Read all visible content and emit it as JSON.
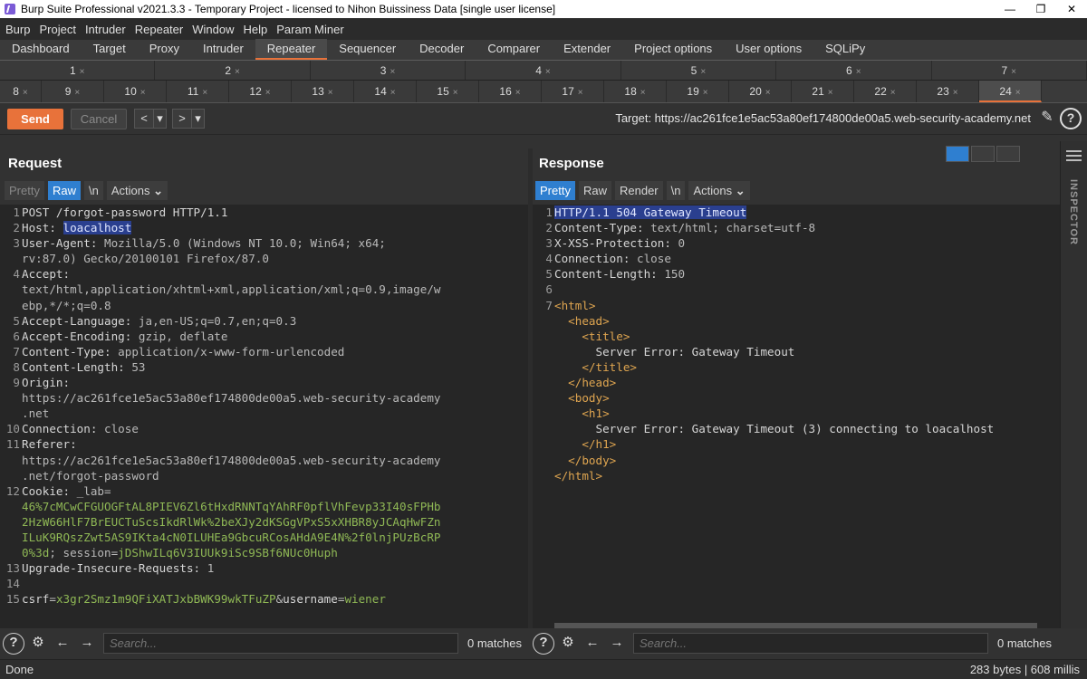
{
  "window": {
    "title": "Burp Suite Professional v2021.3.3 - Temporary Project - licensed to Nihon Buissiness Data [single user license]",
    "min": "—",
    "restore": "❐",
    "close": "✕"
  },
  "menu": [
    "Burp",
    "Project",
    "Intruder",
    "Repeater",
    "Window",
    "Help",
    "Param Miner"
  ],
  "main_tabs": [
    "Dashboard",
    "Target",
    "Proxy",
    "Intruder",
    "Repeater",
    "Sequencer",
    "Decoder",
    "Comparer",
    "Extender",
    "Project options",
    "User options",
    "SQLiPy"
  ],
  "active_main_tab": "Repeater",
  "repeater_tabs_row1": [
    "1",
    "2",
    "3",
    "4",
    "5",
    "6",
    "7"
  ],
  "repeater_tabs_row2": [
    "8",
    "9",
    "10",
    "11",
    "12",
    "13",
    "14",
    "15",
    "16",
    "17",
    "18",
    "19",
    "20",
    "21",
    "22",
    "23",
    "24"
  ],
  "active_repeater_tab": "24",
  "toolbar": {
    "send": "Send",
    "cancel": "Cancel",
    "back": "<",
    "fwd": ">",
    "dropdown": "▾",
    "target": "Target: https://ac261fce1e5ac53a80ef174800de00a5.web-security-academy.net",
    "edit_icon": "✎",
    "help_icon": "?"
  },
  "request": {
    "title": "Request",
    "tabs": [
      "Pretty",
      "Raw",
      "\\n"
    ],
    "active_tab": "Raw",
    "actions": "Actions",
    "search_placeholder": "Search...",
    "matches": "0 matches"
  },
  "response": {
    "title": "Response",
    "tabs": [
      "Pretty",
      "Raw",
      "Render",
      "\\n"
    ],
    "active_tab": "Pretty",
    "actions": "Actions",
    "search_placeholder": "Search...",
    "matches": "0 matches"
  },
  "inspector": "INSPECTOR",
  "status": {
    "left": "Done",
    "right": "283 bytes | 608 millis"
  },
  "request_lines": [
    [
      "1",
      [
        [
          "POST /forgot-password HTTP/1.1",
          ""
        ]
      ]
    ],
    [
      "2",
      [
        [
          "Host: ",
          ""
        ],
        [
          "loacalhost",
          "hl"
        ]
      ]
    ],
    [
      "3",
      [
        [
          "User-Agent: ",
          ""
        ],
        [
          "Mozilla/5.0 (Windows NT 10.0; Win64; x64;",
          "val"
        ]
      ]
    ],
    [
      "",
      [
        [
          "rv:87.0) Gecko/20100101 Firefox/87.0",
          "val"
        ]
      ]
    ],
    [
      "4",
      [
        [
          "Accept:",
          ""
        ]
      ]
    ],
    [
      "",
      [
        [
          "text/html,application/xhtml+xml,application/xml;q=0.9,image/w",
          "val"
        ]
      ]
    ],
    [
      "",
      [
        [
          "ebp,*/*;q=0.8",
          "val"
        ]
      ]
    ],
    [
      "5",
      [
        [
          "Accept-Language: ",
          ""
        ],
        [
          "ja,en-US;q=0.7,en;q=0.3",
          "val"
        ]
      ]
    ],
    [
      "6",
      [
        [
          "Accept-Encoding: ",
          ""
        ],
        [
          "gzip, deflate",
          "val"
        ]
      ]
    ],
    [
      "7",
      [
        [
          "Content-Type: ",
          ""
        ],
        [
          "application/x-www-form-urlencoded",
          "val"
        ]
      ]
    ],
    [
      "8",
      [
        [
          "Content-Length: ",
          ""
        ],
        [
          "53",
          "val"
        ]
      ]
    ],
    [
      "9",
      [
        [
          "Origin:",
          ""
        ]
      ]
    ],
    [
      "",
      [
        [
          "https://ac261fce1e5ac53a80ef174800de00a5.web-security-academy",
          "val"
        ]
      ]
    ],
    [
      "",
      [
        [
          ".net",
          "val"
        ]
      ]
    ],
    [
      "10",
      [
        [
          "Connection: ",
          ""
        ],
        [
          "close",
          "val"
        ]
      ]
    ],
    [
      "11",
      [
        [
          "Referer:",
          ""
        ]
      ]
    ],
    [
      "",
      [
        [
          "https://ac261fce1e5ac53a80ef174800de00a5.web-security-academy",
          "val"
        ]
      ]
    ],
    [
      "",
      [
        [
          ".net/forgot-password",
          "val"
        ]
      ]
    ],
    [
      "12",
      [
        [
          "Cookie: ",
          ""
        ],
        [
          "_lab=",
          "val"
        ]
      ]
    ],
    [
      "",
      [
        [
          "46%7cMCwCFGUOGFtAL8PIEV6Zl6tHxdRNNTqYAhRF0pflVhFevp33I40sFPHb",
          "grn"
        ]
      ]
    ],
    [
      "",
      [
        [
          "2HzW66HlF7BrEUCTuScsIkdRlWk%2beXJy2dKSGgVPxS5xXHBR8yJCAqHwFZn",
          "grn"
        ]
      ]
    ],
    [
      "",
      [
        [
          "ILuK9RQszZwt5AS9IKta4cN0ILUHEa9GbcuRCosAHdA9E4N%2f0lnjPUzBcRP",
          "grn"
        ]
      ]
    ],
    [
      "",
      [
        [
          "0%3d",
          "grn"
        ],
        [
          "; session=",
          "val"
        ],
        [
          "jDShwILq6V3IUUk9iSc9SBf6NUc0Huph",
          "grn"
        ]
      ]
    ],
    [
      "13",
      [
        [
          "Upgrade-Insecure-Requests: ",
          ""
        ],
        [
          "1",
          "val"
        ]
      ]
    ],
    [
      "14",
      [
        [
          "",
          ""
        ]
      ]
    ],
    [
      "15",
      [
        [
          "csrf",
          ""
        ],
        [
          "=",
          "val"
        ],
        [
          "x3gr2Smz1m9QFiXATJxbBWK99wkTFuZP",
          "grn"
        ],
        [
          "&",
          "val"
        ],
        [
          "username",
          ""
        ],
        [
          "=",
          "val"
        ],
        [
          "wiener",
          "grn"
        ]
      ]
    ]
  ],
  "response_lines": [
    [
      "1",
      [
        [
          "HTTP/1.1 504 Gateway Timeout",
          "hl"
        ]
      ]
    ],
    [
      "2",
      [
        [
          "Content-Type: ",
          ""
        ],
        [
          "text/html; charset=utf-8",
          "val"
        ]
      ]
    ],
    [
      "3",
      [
        [
          "X-XSS-Protection: ",
          ""
        ],
        [
          "0",
          "val"
        ]
      ]
    ],
    [
      "4",
      [
        [
          "Connection: ",
          ""
        ],
        [
          "close",
          "val"
        ]
      ]
    ],
    [
      "5",
      [
        [
          "Content-Length: ",
          ""
        ],
        [
          "150",
          "val"
        ]
      ]
    ],
    [
      "6",
      [
        [
          "",
          ""
        ]
      ]
    ],
    [
      "7",
      [
        [
          "<html>",
          "tag"
        ]
      ]
    ],
    [
      "",
      [
        [
          "  <head>",
          "tag"
        ]
      ]
    ],
    [
      "",
      [
        [
          "    <title>",
          "tag"
        ]
      ]
    ],
    [
      "",
      [
        [
          "      Server Error: Gateway Timeout",
          ""
        ]
      ]
    ],
    [
      "",
      [
        [
          "    </title>",
          "tag"
        ]
      ]
    ],
    [
      "",
      [
        [
          "  </head>",
          "tag"
        ]
      ]
    ],
    [
      "",
      [
        [
          "  <body>",
          "tag"
        ]
      ]
    ],
    [
      "",
      [
        [
          "    <h1>",
          "tag"
        ]
      ]
    ],
    [
      "",
      [
        [
          "      Server Error: Gateway Timeout (3) connecting to loacalhost",
          ""
        ]
      ]
    ],
    [
      "",
      [
        [
          "    </h1>",
          "tag"
        ]
      ]
    ],
    [
      "",
      [
        [
          "  </body>",
          "tag"
        ]
      ]
    ],
    [
      "",
      [
        [
          "</html>",
          "tag"
        ]
      ]
    ]
  ]
}
